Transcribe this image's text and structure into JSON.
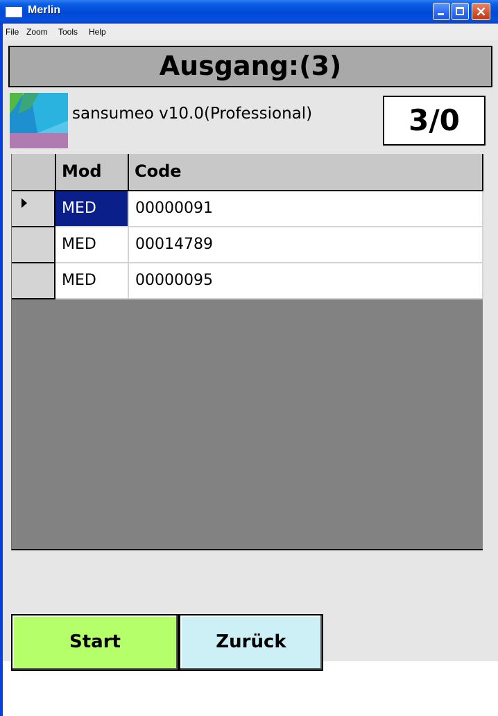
{
  "window": {
    "title": "Merlin",
    "colors": {
      "titlebar": "#0049d6",
      "client_bg": "#e6e6e6"
    }
  },
  "menu": [
    {
      "label": "File"
    },
    {
      "label": "Zoom"
    },
    {
      "label": "Tools"
    },
    {
      "label": "Help"
    }
  ],
  "header": {
    "title": "Ausgang:(3)"
  },
  "info": {
    "version": "sansumeo v10.0(Professional)",
    "counter": "3/0",
    "logo_icon": "sansumeo-logo-icon"
  },
  "grid": {
    "columns": [
      "",
      "Mod",
      "Code"
    ],
    "rows": [
      {
        "mod": "MED",
        "code": "00000091",
        "current": true
      },
      {
        "mod": "MED",
        "code": "00014789",
        "current": false
      },
      {
        "mod": "MED",
        "code": "00000095",
        "current": false
      }
    ],
    "colors": {
      "header_bg": "#c8c8c8",
      "empty_bg": "#828282",
      "selected_bg": "#0a1f8a"
    }
  },
  "buttons": {
    "start": {
      "label": "Start",
      "color": "#b5ff6b"
    },
    "back": {
      "label": "Zurück",
      "color": "#cdf0f6"
    }
  }
}
